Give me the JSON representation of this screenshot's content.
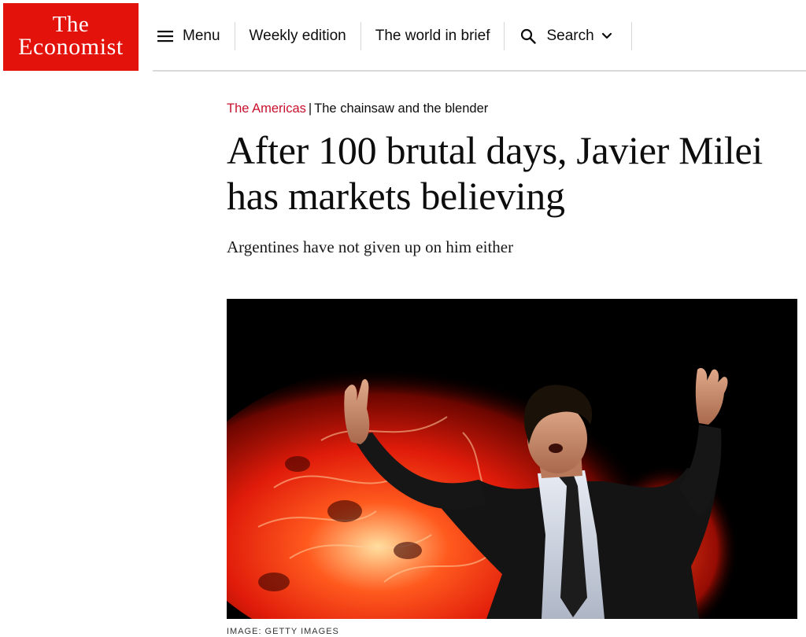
{
  "brand": {
    "logo_line1": "The",
    "logo_line2": "Economist",
    "logo_color": "#e3120b"
  },
  "nav": {
    "menu_label": "Menu",
    "menu_icon": "hamburger-icon",
    "weekly_label": "Weekly edition",
    "brief_label": "The world in brief",
    "search_label": "Search",
    "search_icon": "magnifier-icon",
    "search_chevron_icon": "chevron-down-icon"
  },
  "article": {
    "section": "The Americas",
    "separator": "|",
    "flytitle": "The chainsaw and the blender",
    "headline": "After 100 brutal days, Javier Milei has markets believing",
    "standfirst": "Argentines have not given up on him either",
    "image_alt": "Javier Milei with arms outstretched in front of a red background",
    "image_caption": "IMAGE: GETTY IMAGES"
  },
  "colors": {
    "section_red": "#c8102e",
    "text": "#0d0d0d",
    "rule": "#d9d9d9"
  }
}
